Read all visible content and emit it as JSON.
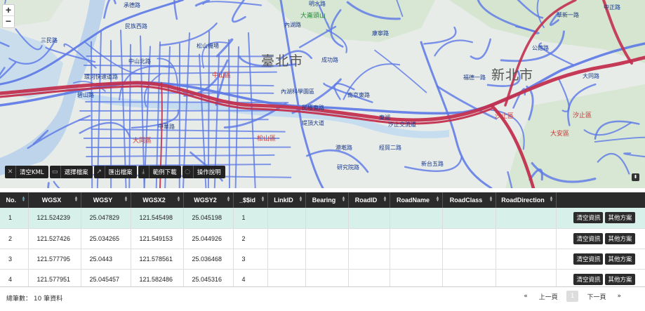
{
  "map": {
    "cities": [
      "臺北市",
      "新北市"
    ],
    "districts": [
      "中山區",
      "松山區",
      "大同區",
      "汐止區",
      "大安區",
      "汐止區"
    ],
    "mountains": [
      "大崙頭山"
    ],
    "roads": [
      "承德路",
      "民族西路",
      "三民路",
      "環河快速道路",
      "中山北路",
      "中華路",
      "內湖路",
      "堤頂大道",
      "南京東路",
      "成功路",
      "民權東路",
      "東湖",
      "汐止交流道",
      "港墘路",
      "研究院路",
      "經貿二路",
      "華新一路",
      "公館路",
      "大同路",
      "新台五路",
      "福德一路",
      "康寧路",
      "內湖科學園區",
      "松山機場",
      "明水路",
      "碧山路",
      "中正路"
    ],
    "zoom_in": "+",
    "zoom_out": "−"
  },
  "toolbar": [
    {
      "icon": "close-icon",
      "glyph": "✕",
      "label": "清空KML"
    },
    {
      "icon": "folder-icon",
      "glyph": "▭",
      "label": "選擇檔案"
    },
    {
      "icon": "export-icon",
      "glyph": "↗",
      "label": "匯出檔案"
    },
    {
      "icon": "download-icon",
      "glyph": "⤓",
      "label": "範例下載"
    },
    {
      "icon": "help-icon",
      "glyph": "◌",
      "label": "操作說明"
    }
  ],
  "table": {
    "columns": [
      "No.",
      "WGSX",
      "WGSY",
      "WGSX2",
      "WGSY2",
      "_$$id",
      "LinkID",
      "Bearing",
      "RoadID",
      "RoadName",
      "RoadClass",
      "RoadDirection",
      ""
    ],
    "rows": [
      {
        "no": "1",
        "wgsx": "121.524239",
        "wgsy": "25.047829",
        "wgsx2": "121.545498",
        "wgsy2": "25.045198",
        "id": "1",
        "selected": true
      },
      {
        "no": "2",
        "wgsx": "121.527426",
        "wgsy": "25.034265",
        "wgsx2": "121.549153",
        "wgsy2": "25.044926",
        "id": "2",
        "selected": false
      },
      {
        "no": "3",
        "wgsx": "121.577795",
        "wgsy": "25.0443",
        "wgsx2": "121.578561",
        "wgsy2": "25.036468",
        "id": "3",
        "selected": false
      },
      {
        "no": "4",
        "wgsx": "121.577951",
        "wgsy": "25.045457",
        "wgsx2": "121.582486",
        "wgsy2": "25.045316",
        "id": "4",
        "selected": false
      }
    ],
    "row_actions": {
      "clear": "清空資訊",
      "other": "其他方案"
    }
  },
  "footer": {
    "total": "總筆數： 10 筆資料",
    "prev": "上一頁",
    "page": "1",
    "next": "下一頁",
    "first": "«",
    "last": "»"
  }
}
